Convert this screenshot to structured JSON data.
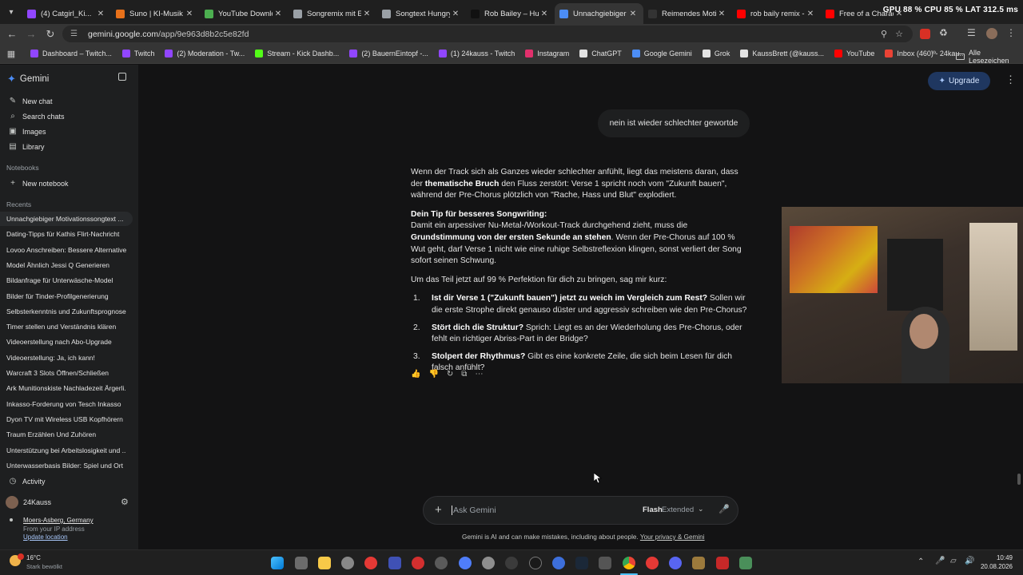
{
  "browser": {
    "tabs": [
      {
        "label": "(4) Catgirl_Ki...",
        "color": "#9146ff"
      },
      {
        "label": "Suno | KI-Musik",
        "color": "#e8711a"
      },
      {
        "label": "YouTube Downlo...",
        "color": "#4caf50"
      },
      {
        "label": "Songremix mit Ei...",
        "color": "#9aa0a6"
      },
      {
        "label": "Songtext Hungry...",
        "color": "#9aa0a6"
      },
      {
        "label": "Rob Bailey – Hun...",
        "color": "#111111"
      },
      {
        "label": "Unnachgiebiger M...",
        "color": "#4c8df6"
      },
      {
        "label": "Reimendes Motiv...",
        "color": "#333333"
      },
      {
        "label": "rob baily remix - ...",
        "color": "#ff0000"
      },
      {
        "label": "Free of a Charact...",
        "color": "#ff0000"
      }
    ],
    "system_stats": "GPU 88 %  CPU 85 %  LAT 312.5 ms",
    "url_domain": "gemini.google.com",
    "url_path": "/app/9e963d8b2c5e82fd",
    "bookmarks": [
      {
        "label": "Dashboard – Twitch...",
        "color": "#9146ff"
      },
      {
        "label": "Twitch",
        "color": "#9146ff"
      },
      {
        "label": "(2) Moderation - Tw...",
        "color": "#9146ff"
      },
      {
        "label": "Stream - Kick Dashb...",
        "color": "#53fc18"
      },
      {
        "label": "(2) BauernEintopf -...",
        "color": "#9146ff"
      },
      {
        "label": "(1) 24kauss - Twitch",
        "color": "#9146ff"
      },
      {
        "label": "Instagram",
        "color": "#e1306c"
      },
      {
        "label": "ChatGPT",
        "color": "#e3e3e3"
      },
      {
        "label": "Google Gemini",
        "color": "#4c8df6"
      },
      {
        "label": "Grok",
        "color": "#e3e3e3"
      },
      {
        "label": "KaussBrett (@kauss...",
        "color": "#e3e3e3"
      },
      {
        "label": "YouTube",
        "color": "#ff0000"
      },
      {
        "label": "Inbox (460) - 24kau...",
        "color": "#ea4335"
      }
    ],
    "all_bookmarks": "Alle Lesezeichen"
  },
  "sidebar": {
    "brand": "Gemini",
    "nav": [
      {
        "label": "New chat",
        "icon": "edit-icon"
      },
      {
        "label": "Search chats",
        "icon": "search-icon"
      },
      {
        "label": "Images",
        "icon": "image-icon"
      },
      {
        "label": "Library",
        "icon": "library-icon"
      }
    ],
    "notebooks_label": "Notebooks",
    "new_notebook": "New notebook",
    "recents_label": "Recents",
    "recents": [
      "Unnachgiebiger Motivationssongtext ...",
      "Dating-Tipps für Kathis Flirt-Nachricht",
      "Lovoo Anschreiben: Bessere Alternativen",
      "Model Ähnlich Jessi Q Generieren",
      "Bildanfrage für Unterwäsche-Model",
      "Bilder für Tinder-Profilgenerierung",
      "Selbsterkenntnis und Zukunftsprognose",
      "Timer stellen und Verständnis klären",
      "Videoerstellung nach Abo-Upgrade",
      "Videoerstellung: Ja, ich kann!",
      "Warcraft 3 Slots Öffnen/Schließen",
      "Ark Munitionskiste Nachladezeit Ärgerli...",
      "Inkasso-Forderung von Tesch Inkasso",
      "Dyon TV mit Wireless USB Kopfhörern",
      "Traum Erzählen Und Zuhören",
      "Unterstützung bei Arbeitslosigkeit und ...",
      "Unterwasserbasis Bilder: Spiel und Ort"
    ],
    "activity": "Activity",
    "user": "24Kauss",
    "location": "Moers-Asberg, Germany",
    "location_sub": "From your IP address",
    "update_location": "Update location"
  },
  "header": {
    "upgrade": "Upgrade"
  },
  "chat": {
    "user_message": "nein ist wieder schlechter gewortde",
    "p1_a": "Wenn der Track sich als Ganzes wieder schlechter anfühlt, liegt das meistens daran, dass der ",
    "p1_b": "thematische Bruch",
    "p1_c": " den Fluss zerstört: Verse 1 spricht noch vom \"Zukunft bauen\", während der Pre-Chorus plötzlich von \"Rache, Hass und Blut\" explodiert.",
    "tip_heading": "Dein Tip für besseres Songwriting:",
    "p2_a": "Damit ein arpessiver Nu-Metal-/Workout-Track durchgehend zieht, muss die ",
    "p2_b": "Grundstimmung von der ersten Sekunde an stehen",
    "p2_c": ". Wenn der Pre-Chorus auf 100 % Wut geht, darf Verse 1 nicht wie eine ruhige Selbstreflexion klingen, sonst verliert der Song sofort seinen Schwung.",
    "p3": "Um das Teil jetzt auf 99 % Perfektion für dich zu bringen, sag mir kurz:",
    "list": [
      {
        "num": "1.",
        "bold": "Ist dir Verse 1 (\"Zukunft bauen\") jetzt zu weich im Vergleich zum Rest?",
        "rest": " Sollen wir die erste Strophe direkt genauso düster und aggressiv schreiben wie den Pre-Chorus?"
      },
      {
        "num": "2.",
        "bold": "Stört dich die Struktur?",
        "rest": " Sprich: Liegt es an der Wiederholung des Pre-Chorus, oder fehlt ein richtiger Abriss-Part in der Bridge?"
      },
      {
        "num": "3.",
        "bold": "Stolpert der Rhythmus?",
        "rest": " Gibt es eine konkrete Zeile, die sich beim Lesen für dich falsch anfühlt?"
      }
    ]
  },
  "input": {
    "placeholder": "Ask Gemini",
    "model": "Flash",
    "mode": "Extended"
  },
  "disclaimer": {
    "text": "Gemini is AI and can make mistakes, including about people. ",
    "link": "Your privacy & Gemini"
  },
  "taskbar": {
    "weather_temp": "16°C",
    "weather_desc": "Stark bewölkt",
    "time": "10:49",
    "date": "20.08.2026"
  }
}
